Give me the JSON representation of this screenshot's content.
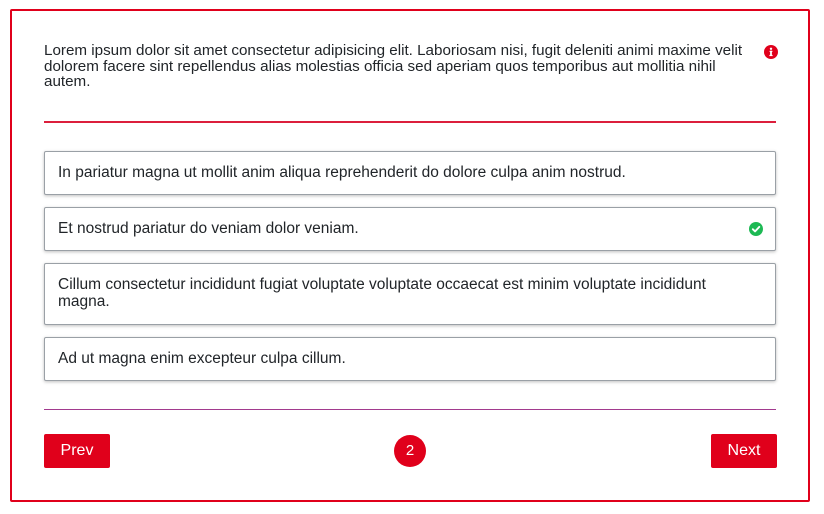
{
  "question": {
    "text": "Lorem ipsum dolor sit amet consectetur adipisicing elit. Laboriosam nisi, fugit deleniti animi maxime velit dolorem facere sint repellendus alias molestias officia sed aperiam quos temporibus aut mollitia nihil autem.",
    "icon": "info-icon"
  },
  "answers": [
    {
      "text": "In pariatur magna ut mollit anim aliqua reprehenderit do dolore culpa anim nostrud.",
      "selected": false
    },
    {
      "text": "Et nostrud pariatur do veniam dolor veniam.",
      "selected": true,
      "icon": "check-circle-icon"
    },
    {
      "text": "Cillum consectetur incididunt fugiat voluptate voluptate occaecat est minim voluptate incididunt magna.",
      "selected": false
    },
    {
      "text": "Ad ut magna enim excepteur culpa cillum.",
      "selected": false
    }
  ],
  "navigation": {
    "prev_label": "Prev",
    "next_label": "Next",
    "current_page": "2"
  },
  "colors": {
    "accent": "#e0001b",
    "success": "#1db954",
    "bottom_divider": "#a23a8e"
  }
}
